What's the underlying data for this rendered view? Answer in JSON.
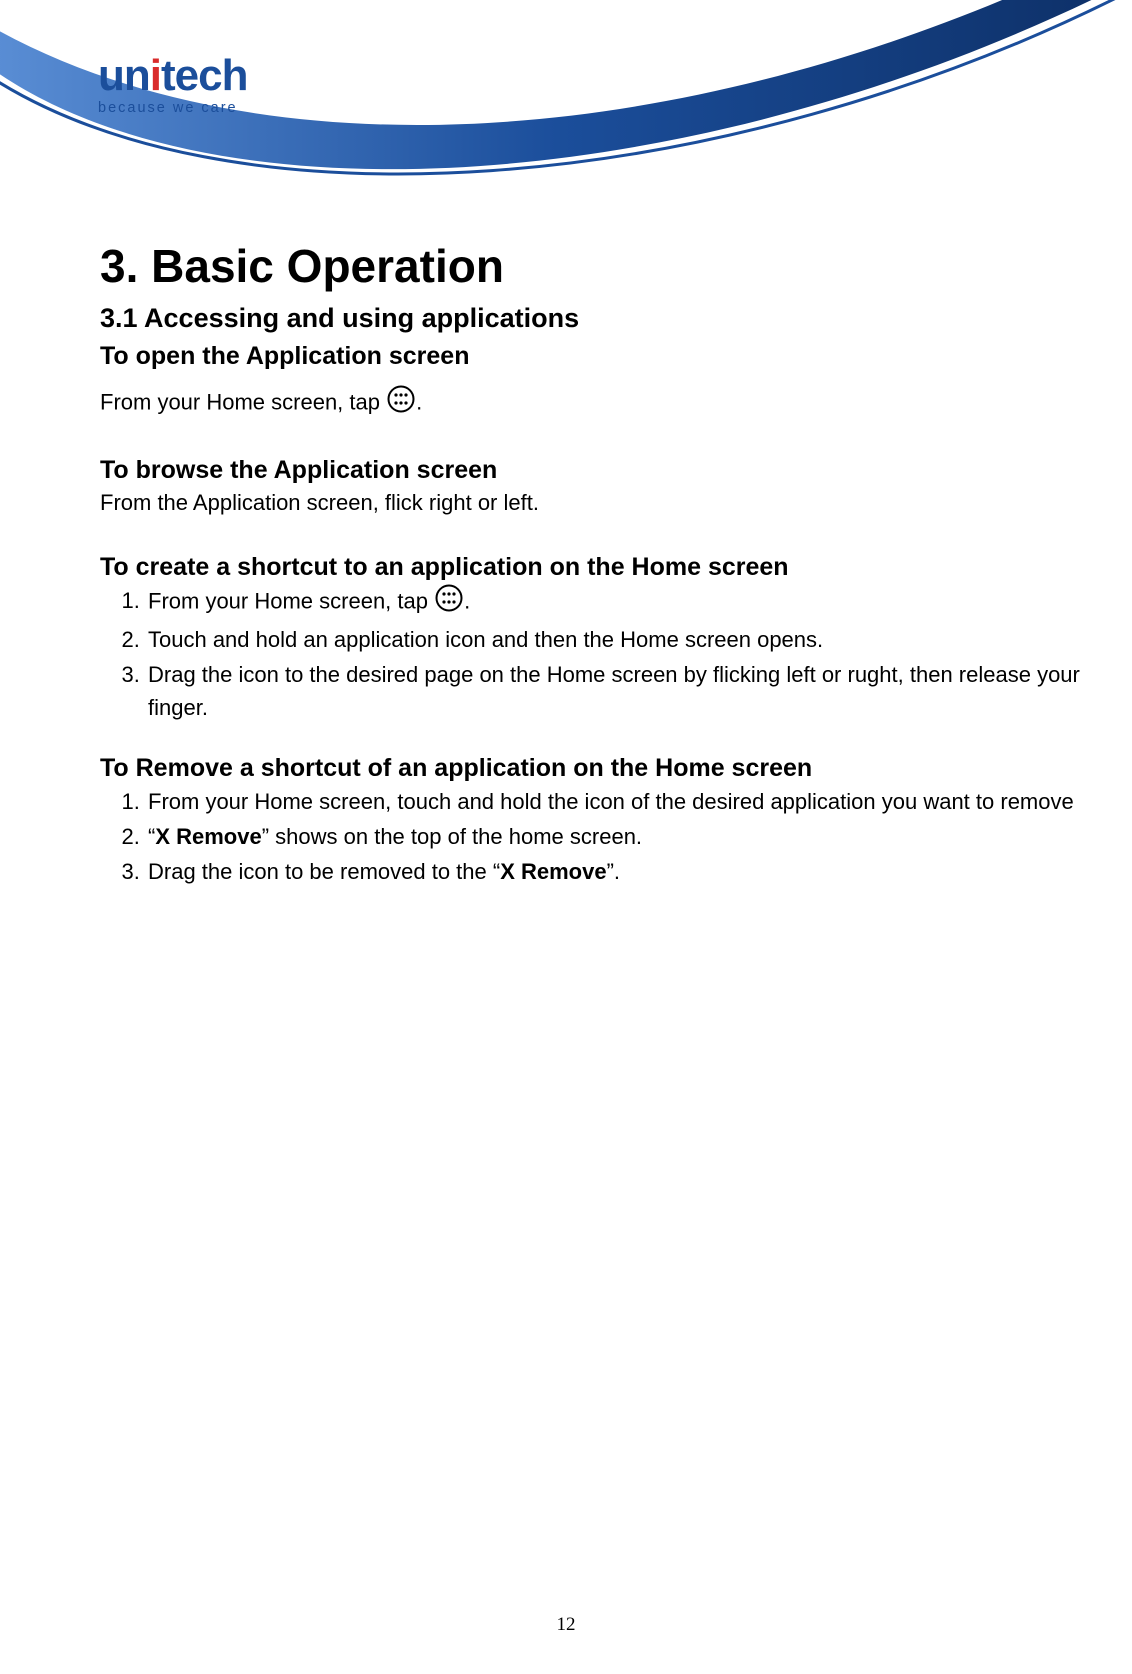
{
  "brand": {
    "name_main": "un",
    "name_accent_letter": "i",
    "name_rest": "tech",
    "tagline": "because we care"
  },
  "page_number": "12",
  "headings": {
    "chapter": "3. Basic Operation",
    "section": "3.1 Accessing and using applications",
    "open_app_screen": "To open the Application screen",
    "browse_app_screen": "To browse the Application screen",
    "create_shortcut": "To create a shortcut to an application on the Home screen",
    "remove_shortcut": "To Remove a shortcut of an application on the Home screen"
  },
  "body": {
    "open_prefix": "From your Home screen, tap ",
    "open_suffix": ".",
    "browse": "From the Application screen, flick right or left.",
    "create_steps": {
      "s1_prefix": "From your Home screen, tap ",
      "s1_suffix": ".",
      "s2": "Touch and hold an application icon and then the Home screen opens.",
      "s3": "Drag the icon to the desired page on the Home screen by flicking left or rught, then release your finger."
    },
    "remove_steps": {
      "s1": "From your Home screen, touch and hold the icon of the desired application you want to remove",
      "s2_pre": "“",
      "s2_bold": "X Remove",
      "s2_post": "” shows on the top of the home screen.",
      "s3_pre": "Drag the icon to be removed to the “",
      "s3_bold": "X Remove",
      "s3_post": "”."
    }
  }
}
